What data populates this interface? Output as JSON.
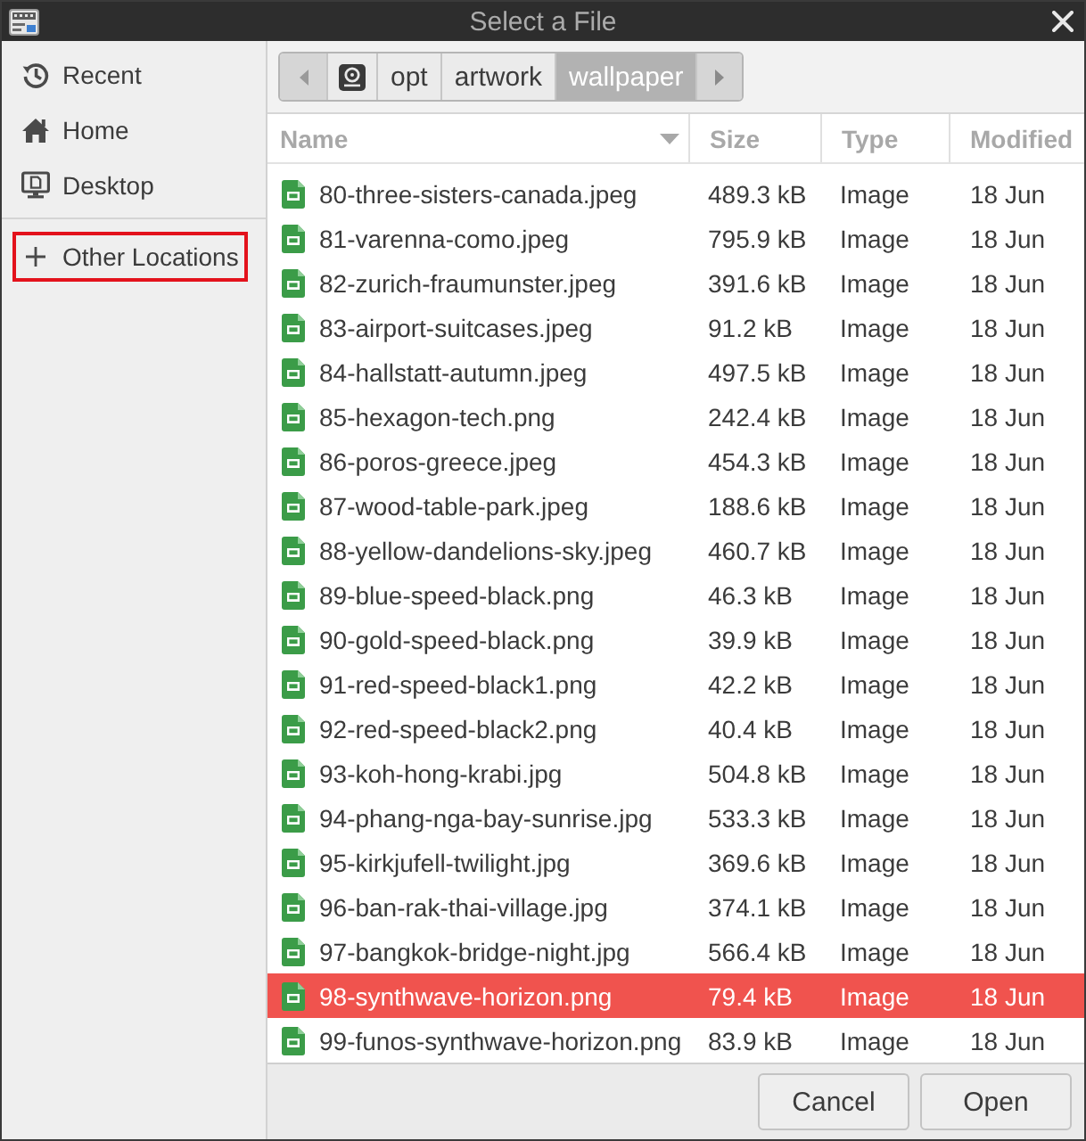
{
  "window": {
    "title": "Select a File"
  },
  "sidebar": {
    "places": [
      {
        "kind": "recent",
        "label": "Recent",
        "highlighted": false
      },
      {
        "kind": "home",
        "label": "Home",
        "highlighted": false
      },
      {
        "kind": "desktop",
        "label": "Desktop",
        "highlighted": false
      }
    ],
    "locations": [
      {
        "kind": "other",
        "label": "Other Locations",
        "highlighted": true
      }
    ]
  },
  "pathbar": {
    "segments": [
      {
        "kind": "drive",
        "selected": false
      },
      {
        "kind": "folder",
        "label": "opt",
        "selected": false
      },
      {
        "kind": "folder",
        "label": "artwork",
        "selected": false
      },
      {
        "kind": "folder",
        "label": "wallpaper",
        "selected": true
      }
    ]
  },
  "file_list": {
    "columns": [
      {
        "label": "Name",
        "sorted": true
      },
      {
        "label": "Size",
        "sorted": false
      },
      {
        "label": "Type",
        "sorted": false
      },
      {
        "label": "Modified",
        "sorted": false
      }
    ],
    "rows": [
      {
        "name": "80-three-sisters-canada.jpeg",
        "size": "489.3 kB",
        "type": "Image",
        "modified": "18 Jun",
        "selected": false
      },
      {
        "name": "81-varenna-como.jpeg",
        "size": "795.9 kB",
        "type": "Image",
        "modified": "18 Jun",
        "selected": false
      },
      {
        "name": "82-zurich-fraumunster.jpeg",
        "size": "391.6 kB",
        "type": "Image",
        "modified": "18 Jun",
        "selected": false
      },
      {
        "name": "83-airport-suitcases.jpeg",
        "size": "91.2 kB",
        "type": "Image",
        "modified": "18 Jun",
        "selected": false
      },
      {
        "name": "84-hallstatt-autumn.jpeg",
        "size": "497.5 kB",
        "type": "Image",
        "modified": "18 Jun",
        "selected": false
      },
      {
        "name": "85-hexagon-tech.png",
        "size": "242.4 kB",
        "type": "Image",
        "modified": "18 Jun",
        "selected": false
      },
      {
        "name": "86-poros-greece.jpeg",
        "size": "454.3 kB",
        "type": "Image",
        "modified": "18 Jun",
        "selected": false
      },
      {
        "name": "87-wood-table-park.jpeg",
        "size": "188.6 kB",
        "type": "Image",
        "modified": "18 Jun",
        "selected": false
      },
      {
        "name": "88-yellow-dandelions-sky.jpeg",
        "size": "460.7 kB",
        "type": "Image",
        "modified": "18 Jun",
        "selected": false
      },
      {
        "name": "89-blue-speed-black.png",
        "size": "46.3 kB",
        "type": "Image",
        "modified": "18 Jun",
        "selected": false
      },
      {
        "name": "90-gold-speed-black.png",
        "size": "39.9 kB",
        "type": "Image",
        "modified": "18 Jun",
        "selected": false
      },
      {
        "name": "91-red-speed-black1.png",
        "size": "42.2 kB",
        "type": "Image",
        "modified": "18 Jun",
        "selected": false
      },
      {
        "name": "92-red-speed-black2.png",
        "size": "40.4 kB",
        "type": "Image",
        "modified": "18 Jun",
        "selected": false
      },
      {
        "name": "93-koh-hong-krabi.jpg",
        "size": "504.8 kB",
        "type": "Image",
        "modified": "18 Jun",
        "selected": false
      },
      {
        "name": "94-phang-nga-bay-sunrise.jpg",
        "size": "533.3 kB",
        "type": "Image",
        "modified": "18 Jun",
        "selected": false
      },
      {
        "name": "95-kirkjufell-twilight.jpg",
        "size": "369.6 kB",
        "type": "Image",
        "modified": "18 Jun",
        "selected": false
      },
      {
        "name": "96-ban-rak-thai-village.jpg",
        "size": "374.1 kB",
        "type": "Image",
        "modified": "18 Jun",
        "selected": false
      },
      {
        "name": "97-bangkok-bridge-night.jpg",
        "size": "566.4 kB",
        "type": "Image",
        "modified": "18 Jun",
        "selected": false
      },
      {
        "name": "98-synthwave-horizon.png",
        "size": "79.4 kB",
        "type": "Image",
        "modified": "18 Jun",
        "selected": true
      },
      {
        "name": "99-funos-synthwave-horizon.png",
        "size": "83.9 kB",
        "type": "Image",
        "modified": "18 Jun",
        "selected": false
      }
    ]
  },
  "buttons": [
    {
      "label": "Cancel"
    },
    {
      "label": "Open"
    }
  ]
}
